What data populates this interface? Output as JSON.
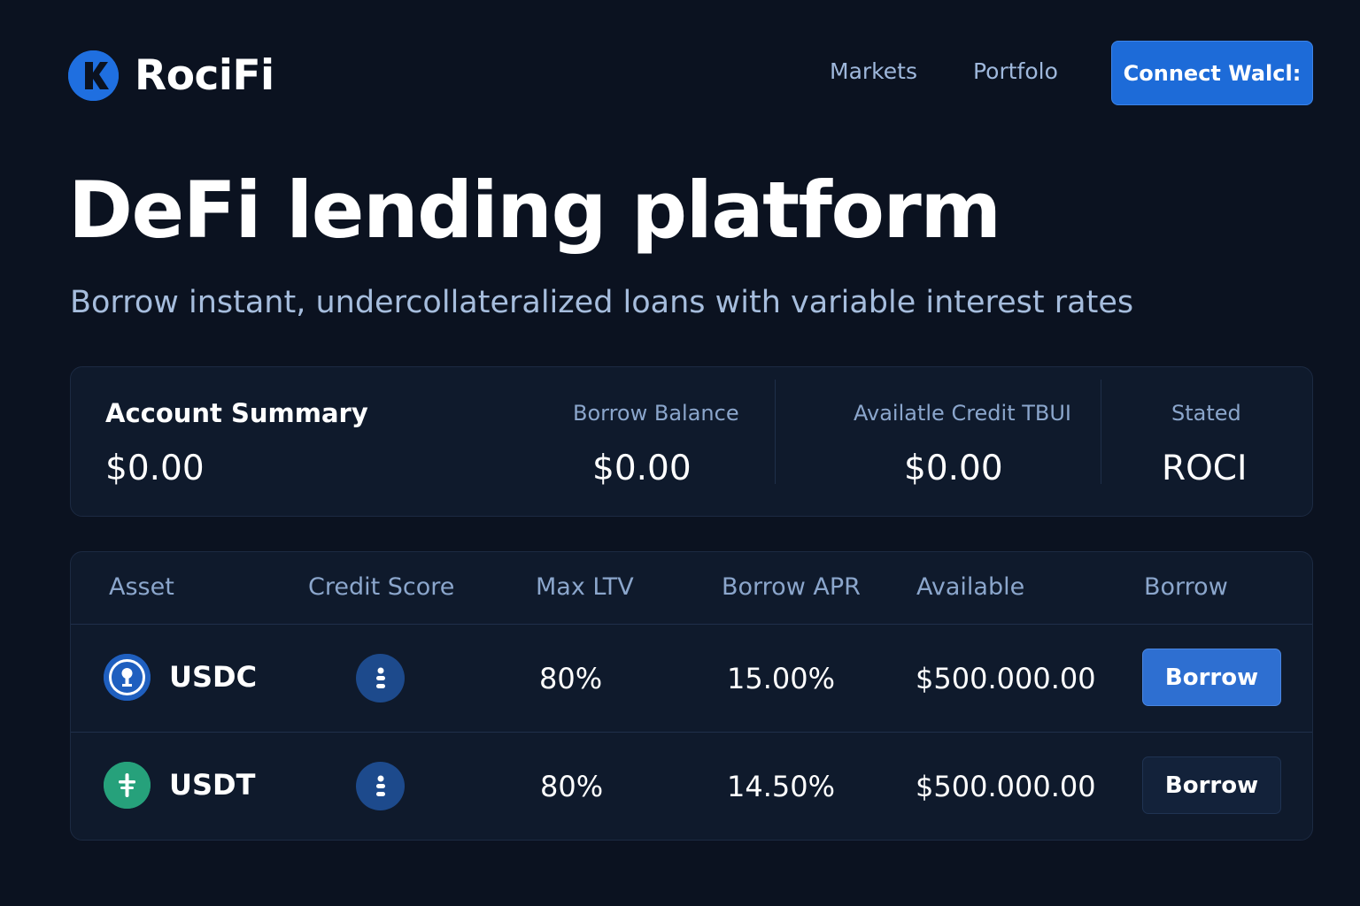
{
  "header": {
    "logo_text": "RociFi",
    "nav": {
      "markets": "Markets",
      "portfolio": "Portfolo"
    },
    "connect_label": "Connect Walcl:"
  },
  "hero": {
    "title": "DeFi lending platform",
    "subtitle": "Borrow instant, undercollateralized loans with variable interest rates"
  },
  "summary": {
    "title": "Account Summary",
    "total": "$0.00",
    "borrow_balance": {
      "label": "Borrow Balance",
      "value": "$0.00"
    },
    "available_credit": {
      "label": "Availatle Credit TBUI",
      "value": "$0.00"
    },
    "stated": {
      "label": "Stated",
      "value": "ROCI"
    }
  },
  "table": {
    "headers": {
      "asset": "Asset",
      "credit_score": "Credit Score",
      "max_ltv": "Max LTV",
      "borrow_apr": "Borrow APR",
      "available": "Available",
      "borrow": "Borrow"
    },
    "rows": [
      {
        "asset": "USDC",
        "icon": "usdc-icon",
        "icon_color": "#1f5fbf",
        "max_ltv": "80%",
        "borrow_apr": "15.00%",
        "available": "$500.000.00",
        "action": "Borrow"
      },
      {
        "asset": "USDT",
        "icon": "usdt-icon",
        "icon_color": "#26a17b",
        "max_ltv": "80%",
        "borrow_apr": "14.50%",
        "available": "$500.000.00",
        "action": "Borrow"
      }
    ]
  },
  "colors": {
    "background": "#0b1220",
    "accent": "#1d6bd8",
    "muted_text": "#8ba6cc"
  }
}
